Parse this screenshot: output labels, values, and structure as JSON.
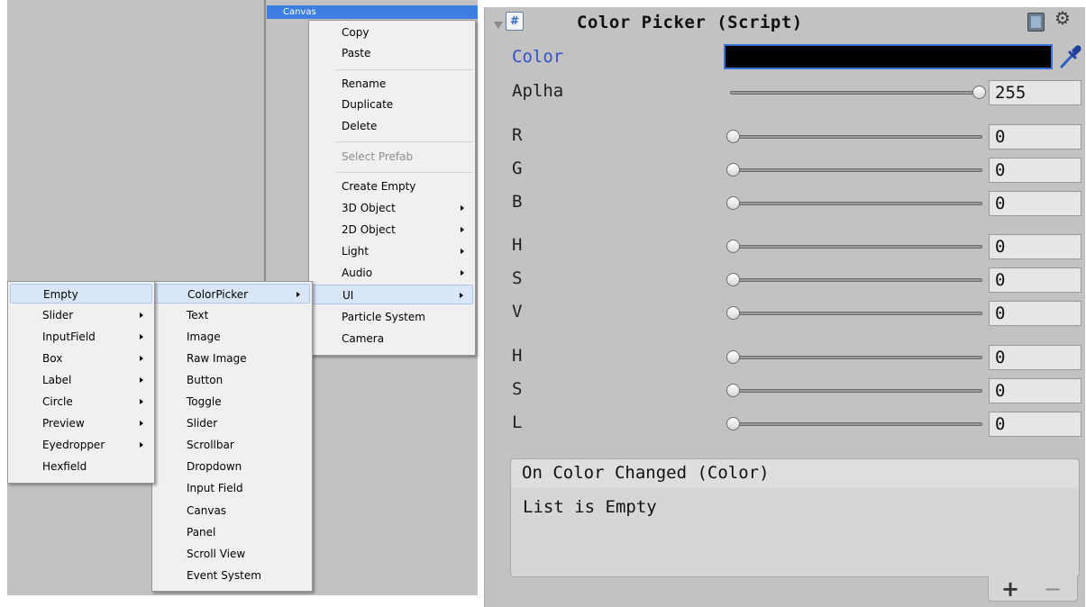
{
  "hierarchy": {
    "selected_item": "Canvas"
  },
  "context_menu": {
    "items": [
      {
        "label": "Copy"
      },
      {
        "label": "Paste"
      },
      {
        "label": "Rename"
      },
      {
        "label": "Duplicate"
      },
      {
        "label": "Delete"
      },
      {
        "label": "Select Prefab",
        "disabled": true
      },
      {
        "label": "Create Empty"
      },
      {
        "label": "3D Object",
        "submenu": true
      },
      {
        "label": "2D Object",
        "submenu": true
      },
      {
        "label": "Light",
        "submenu": true
      },
      {
        "label": "Audio",
        "submenu": true
      },
      {
        "label": "UI",
        "submenu": true,
        "highlighted": true
      },
      {
        "label": "Particle System"
      },
      {
        "label": "Camera"
      }
    ]
  },
  "ui_submenu": {
    "items": [
      {
        "label": "ColorPicker",
        "submenu": true,
        "highlighted": true
      },
      {
        "label": "Text"
      },
      {
        "label": "Image"
      },
      {
        "label": "Raw Image"
      },
      {
        "label": "Button"
      },
      {
        "label": "Toggle"
      },
      {
        "label": "Slider"
      },
      {
        "label": "Scrollbar"
      },
      {
        "label": "Dropdown"
      },
      {
        "label": "Input Field"
      },
      {
        "label": "Canvas"
      },
      {
        "label": "Panel"
      },
      {
        "label": "Scroll View"
      },
      {
        "label": "Event System"
      }
    ]
  },
  "colorpicker_submenu": {
    "items": [
      {
        "label": "Empty",
        "highlighted": true
      },
      {
        "label": "Slider",
        "submenu": true
      },
      {
        "label": "InputField",
        "submenu": true
      },
      {
        "label": "Box",
        "submenu": true
      },
      {
        "label": "Label",
        "submenu": true
      },
      {
        "label": "Circle",
        "submenu": true
      },
      {
        "label": "Preview",
        "submenu": true
      },
      {
        "label": "Eyedropper",
        "submenu": true
      },
      {
        "label": "Hexfield"
      }
    ]
  },
  "inspector": {
    "component_title": "Color Picker (Script)",
    "script_icon_glyph": "#",
    "color_label": "Color",
    "color_value": "#000000",
    "fields": [
      {
        "label": "Aplha",
        "value": "255",
        "fraction": 1.0
      },
      {
        "label": "R",
        "value": "0",
        "fraction": 0
      },
      {
        "label": "G",
        "value": "0",
        "fraction": 0
      },
      {
        "label": "B",
        "value": "0",
        "fraction": 0
      },
      {
        "label": "H",
        "value": "0",
        "fraction": 0
      },
      {
        "label": "S",
        "value": "0",
        "fraction": 0
      },
      {
        "label": "V",
        "value": "0",
        "fraction": 0
      },
      {
        "label": "H",
        "value": "0",
        "fraction": 0
      },
      {
        "label": "S",
        "value": "0",
        "fraction": 0
      },
      {
        "label": "L",
        "value": "0",
        "fraction": 0
      }
    ],
    "event": {
      "header": "On Color Changed (Color)",
      "empty_text": "List is Empty",
      "add_label": "+",
      "remove_label": "−"
    }
  }
}
